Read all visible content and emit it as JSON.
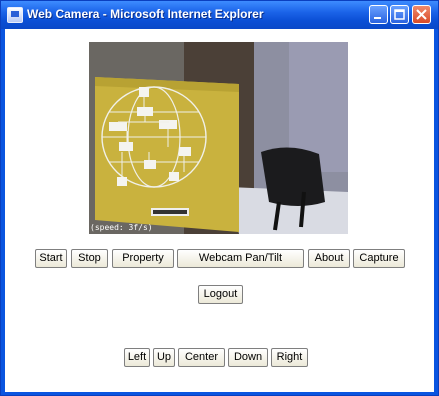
{
  "window": {
    "title": "Web Camera - Microsoft Internet Explorer"
  },
  "camera": {
    "overlay_text": "(speed: 3f/s)"
  },
  "toolbar": {
    "start": "Start",
    "stop": "Stop",
    "property": "Property",
    "pantilt": "Webcam Pan/Tilt",
    "about": "About",
    "capture": "Capture"
  },
  "logout": "Logout",
  "pantilt_controls": {
    "left": "Left",
    "up": "Up",
    "center": "Center",
    "down": "Down",
    "right": "Right"
  }
}
